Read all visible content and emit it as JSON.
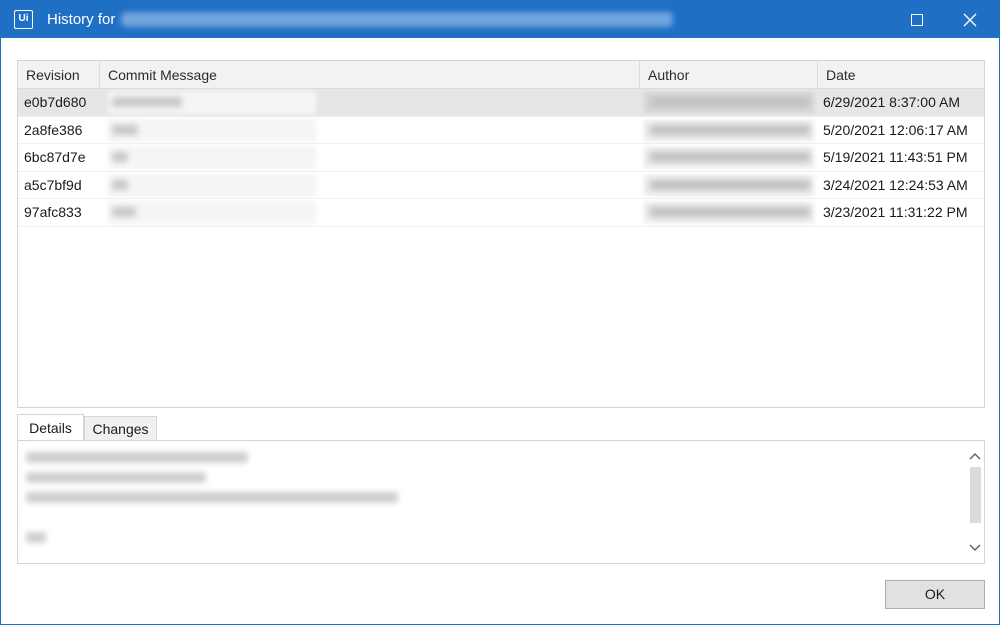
{
  "window": {
    "title": "History for",
    "app_icon_label": "Ui"
  },
  "grid": {
    "columns": [
      "Revision",
      "Commit Message",
      "Author",
      "Date"
    ],
    "rows": [
      {
        "revision": "e0b7d680",
        "date": "6/29/2021 8:37:00 AM",
        "selected": true
      },
      {
        "revision": "2a8fe386",
        "date": "5/20/2021 12:06:17 AM",
        "selected": false
      },
      {
        "revision": "6bc87d7e",
        "date": "5/19/2021 11:43:51 PM",
        "selected": false
      },
      {
        "revision": "a5c7bf9d",
        "date": "3/24/2021 12:24:53 AM",
        "selected": false
      },
      {
        "revision": "97afc833",
        "date": "3/23/2021 11:31:22 PM",
        "selected": false
      }
    ]
  },
  "tabs": {
    "details": "Details",
    "changes": "Changes",
    "active": "Details"
  },
  "buttons": {
    "ok": "OK"
  },
  "colors": {
    "titlebar": "#1f6fc5",
    "selected_row": "#e6e6e6"
  },
  "icons": {
    "app": "uipath-icon",
    "maximize": "maximize-icon",
    "close": "close-icon",
    "scroll_up": "chevron-up-icon",
    "scroll_down": "chevron-down-icon"
  }
}
